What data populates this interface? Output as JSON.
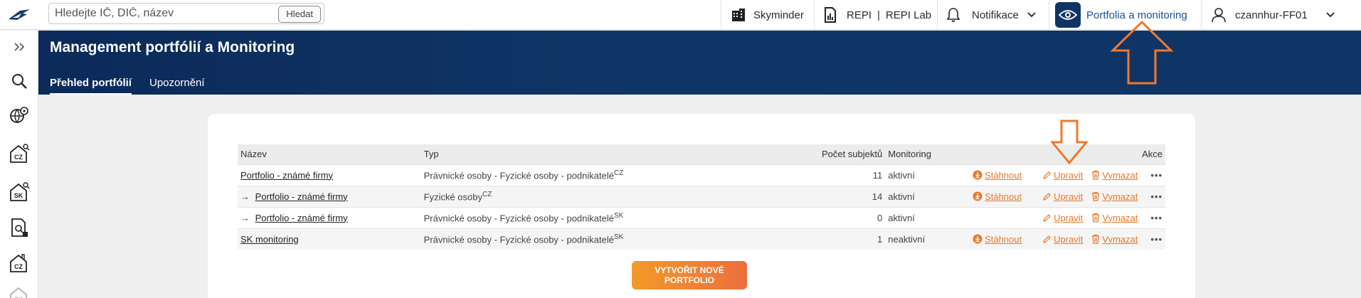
{
  "search": {
    "placeholder": "Hledejte IČ, DIČ, název",
    "button": "Hledat"
  },
  "topbar": {
    "skyminder": "Skyminder",
    "repi": "REPI",
    "repi_sep": "|",
    "repi_lab": "REPI Lab",
    "notifications": "Notifikace",
    "portfolio": "Portfolia a monitoring",
    "user": "czannhur-FF01"
  },
  "header": {
    "title": "Management portfólií a Monitoring",
    "tabs": [
      {
        "label": "Přehled portfólií"
      },
      {
        "label": "Upozornění"
      }
    ]
  },
  "table": {
    "columns": [
      "Název",
      "Typ",
      "Počet subjektů",
      "Monitoring",
      "Akce"
    ],
    "rows": [
      {
        "arrow": "",
        "name": "Portfolio - známé firmy",
        "type": "Právnické osoby - Fyzické osoby - podnikatelé",
        "type_sup": "CZ",
        "count": "11",
        "monitoring": "aktivní",
        "download": "Stáhnout",
        "edit": "Upravit",
        "delete": "Vymazat"
      },
      {
        "arrow": "→",
        "name": "Portfolio - známé firmy",
        "type": "Fyzické osoby",
        "type_sup": "CZ",
        "count": "14",
        "monitoring": "aktivní",
        "download": "Stáhnout",
        "edit": "Upravit",
        "delete": "Vymazat"
      },
      {
        "arrow": "→",
        "name": "Portfolio - známé firmy",
        "type": "Právnické osoby - Fyzické osoby - podnikatelé",
        "type_sup": "SK",
        "count": "0",
        "monitoring": "aktivní",
        "download": "",
        "edit": "Upravit",
        "delete": "Vymazat"
      },
      {
        "arrow": "",
        "name": "SK monitoring",
        "type": "Právnické osoby - Fyzické osoby - podnikatelé",
        "type_sup": "SK",
        "count": "1",
        "monitoring": "neaktivní",
        "download": "Stáhnout",
        "edit": "Upravit",
        "delete": "Vymazat"
      }
    ]
  },
  "new_portfolio_button": "VYTVOŘIT NOVÉ PORTFOLIO",
  "sidebar_badges": {
    "cz": "CZ",
    "sk": "SK"
  },
  "colors": {
    "navy": "#0f3466",
    "accent": "#e8772a",
    "annotation": "#f0782a"
  }
}
